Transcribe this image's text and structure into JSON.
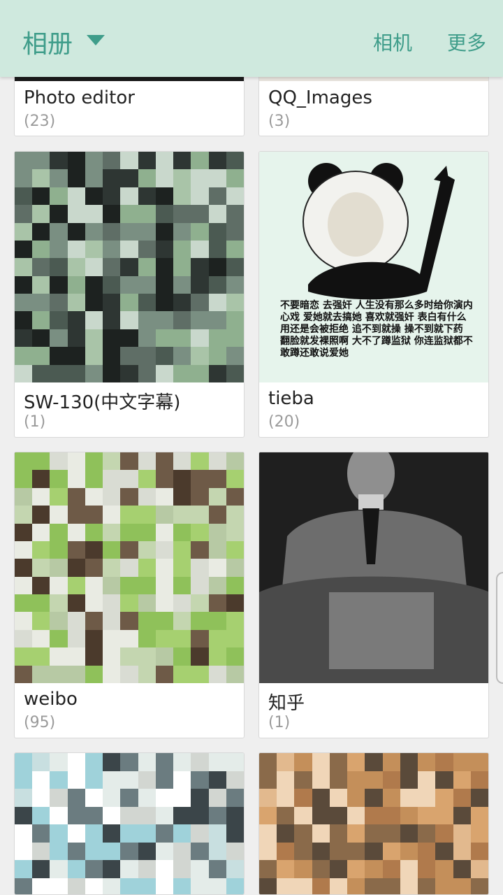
{
  "appbar": {
    "title": "相册",
    "actions": [
      "相机",
      "更多"
    ]
  },
  "albums": [
    {
      "name": "Photo editor",
      "count": "(23)"
    },
    {
      "name": "QQ_Images",
      "count": "(3)"
    },
    {
      "name": "SW-130(中文字幕)",
      "count": "(1)"
    },
    {
      "name": "tieba",
      "count": "(20)"
    },
    {
      "name": "weibo",
      "count": "(95)"
    },
    {
      "name": "知乎",
      "count": "(1)"
    },
    {
      "name": "",
      "count": ""
    },
    {
      "name": "",
      "count": ""
    }
  ],
  "meme_text": "不要暗恋 去强奸 人生没有那么多时给你演内心戏 爱她就去搞她 喜欢就强奸 表白有什么用还是会被拒绝 追不到就操 操不到就下药 翻脸就发裸照啊 大不了蹲监狱 你连监狱都不敢蹲还敢说爱她"
}
